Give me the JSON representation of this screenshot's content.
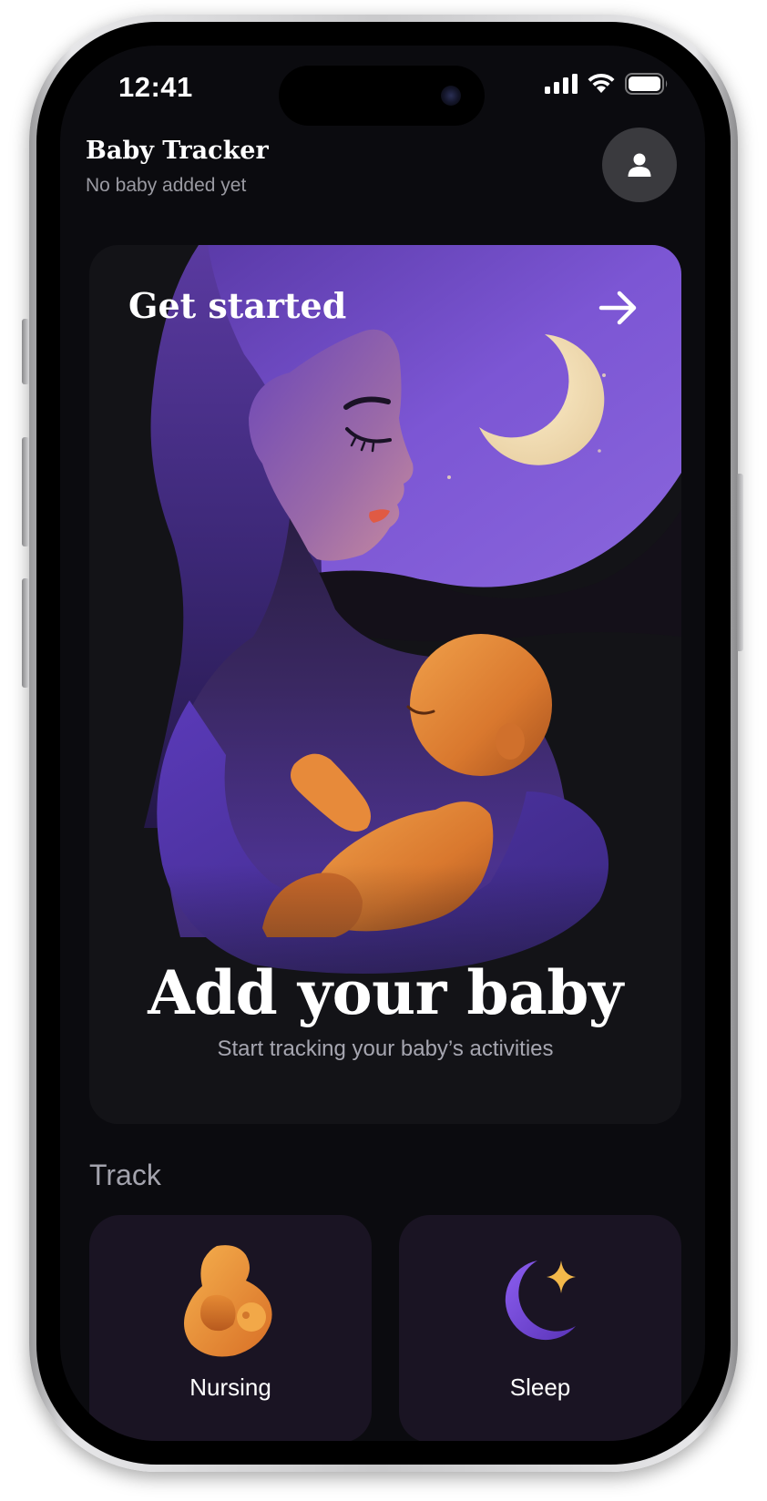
{
  "status_bar": {
    "time": "12:41",
    "icons": [
      "cellular-signal-icon",
      "wifi-icon",
      "battery-icon"
    ]
  },
  "header": {
    "title": "Baby Tracker",
    "subtitle": "No baby added yet",
    "profile_icon": "person-icon"
  },
  "hero": {
    "cta_label": "Get started",
    "cta_icon": "arrow-right-icon",
    "title": "Add your baby",
    "subtitle": "Start tracking your baby’s activities"
  },
  "track": {
    "label": "Track",
    "items": [
      {
        "label": "Nursing",
        "icon": "nursing-mother-icon"
      },
      {
        "label": "Sleep",
        "icon": "moon-star-icon"
      }
    ]
  },
  "colors": {
    "background": "#0b0b0f",
    "card": "#131317",
    "track_card": "#1a1423",
    "accent_purple": "#7b55d6",
    "accent_orange": "#e8893d",
    "moon": "#f3dfb8"
  }
}
